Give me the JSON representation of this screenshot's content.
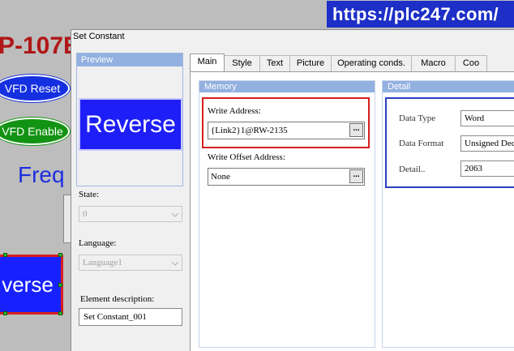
{
  "background": {
    "title_fragment": "P-107E",
    "buttons": [
      "VFD Reset",
      "VFD Enable"
    ],
    "freq_fragment": "Freq",
    "reverse_fragment": "verse"
  },
  "watermark": "https://plc247.com/",
  "dialog": {
    "title": "Set Constant",
    "preview": {
      "label": "Preview",
      "button_text": "Reverse"
    },
    "state": {
      "label": "State:",
      "value": "0"
    },
    "language": {
      "label": "Language:",
      "value": "Language1"
    },
    "element_description": {
      "label": "Element description:",
      "value": "Set Constant_001"
    },
    "tabs": [
      "Main",
      "Style",
      "Text",
      "Picture",
      "Operating conds.",
      "Macro",
      "Coo"
    ],
    "memory": {
      "label": "Memory",
      "write_address_label": "Write Address:",
      "write_address_value": "{Link2}1@RW-2135",
      "write_offset_label": "Write Offset Address:",
      "write_offset_value": "None",
      "browse_label": "..."
    },
    "detail": {
      "label": "Detail",
      "data_type_label": "Data Type",
      "data_type_value": "Word",
      "data_format_label": "Data Format",
      "data_format_value": "Unsigned Deci",
      "detail_label": "Detail..",
      "detail_value": "2063"
    }
  },
  "colors": {
    "highlight_red": "#d81e1e",
    "highlight_blue": "#2b3fc2",
    "group_header": "#92b0e0",
    "watermark_bg": "#1d2fc6"
  }
}
